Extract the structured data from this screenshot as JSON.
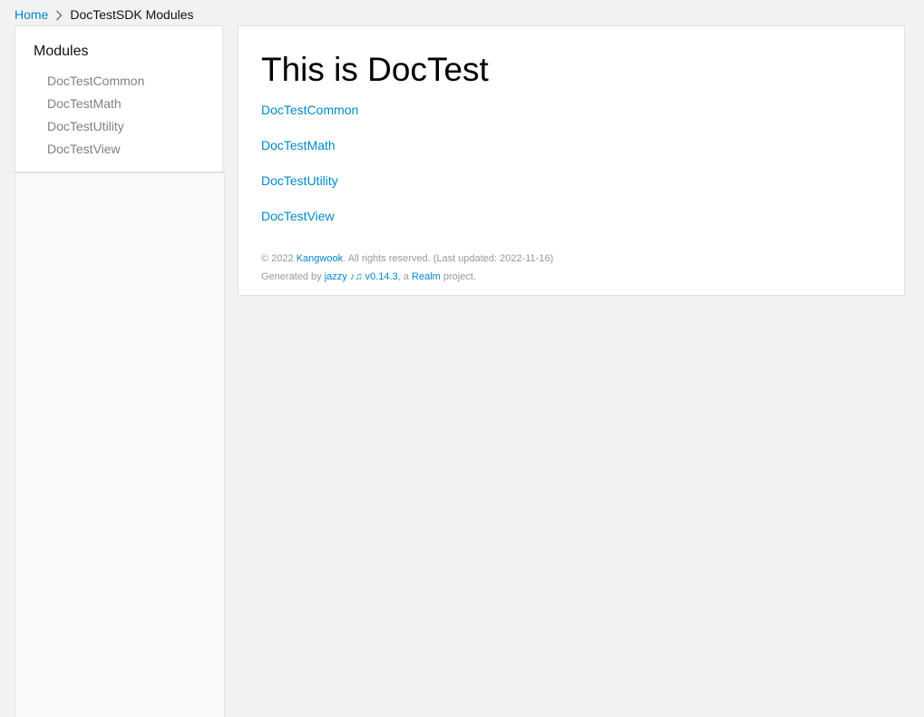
{
  "breadcrumb": {
    "home": "Home",
    "current": "DocTestSDK Modules"
  },
  "sidebar": {
    "title": "Modules",
    "items": [
      {
        "label": "DocTestCommon"
      },
      {
        "label": "DocTestMath"
      },
      {
        "label": "DocTestUtility"
      },
      {
        "label": "DocTestView"
      }
    ]
  },
  "main": {
    "heading": "This is DocTest",
    "links": [
      {
        "label": "DocTestCommon"
      },
      {
        "label": "DocTestMath"
      },
      {
        "label": "DocTestUtility"
      },
      {
        "label": "DocTestView"
      }
    ]
  },
  "footer": {
    "copyright_prefix": "© 2022 ",
    "author": "Kangwook",
    "copyright_suffix": ". All rights reserved. (Last updated: 2022-11-16)",
    "generated_prefix": "Generated by ",
    "jazzy": "jazzy ♪♫ v0.14.3",
    "generated_middle": ", a ",
    "realm": "Realm",
    "generated_suffix": " project."
  },
  "colors": {
    "link": "#0088cc",
    "background": "#f2f2f2",
    "panel": "#ffffff",
    "sidebar_nav": "#808080"
  }
}
